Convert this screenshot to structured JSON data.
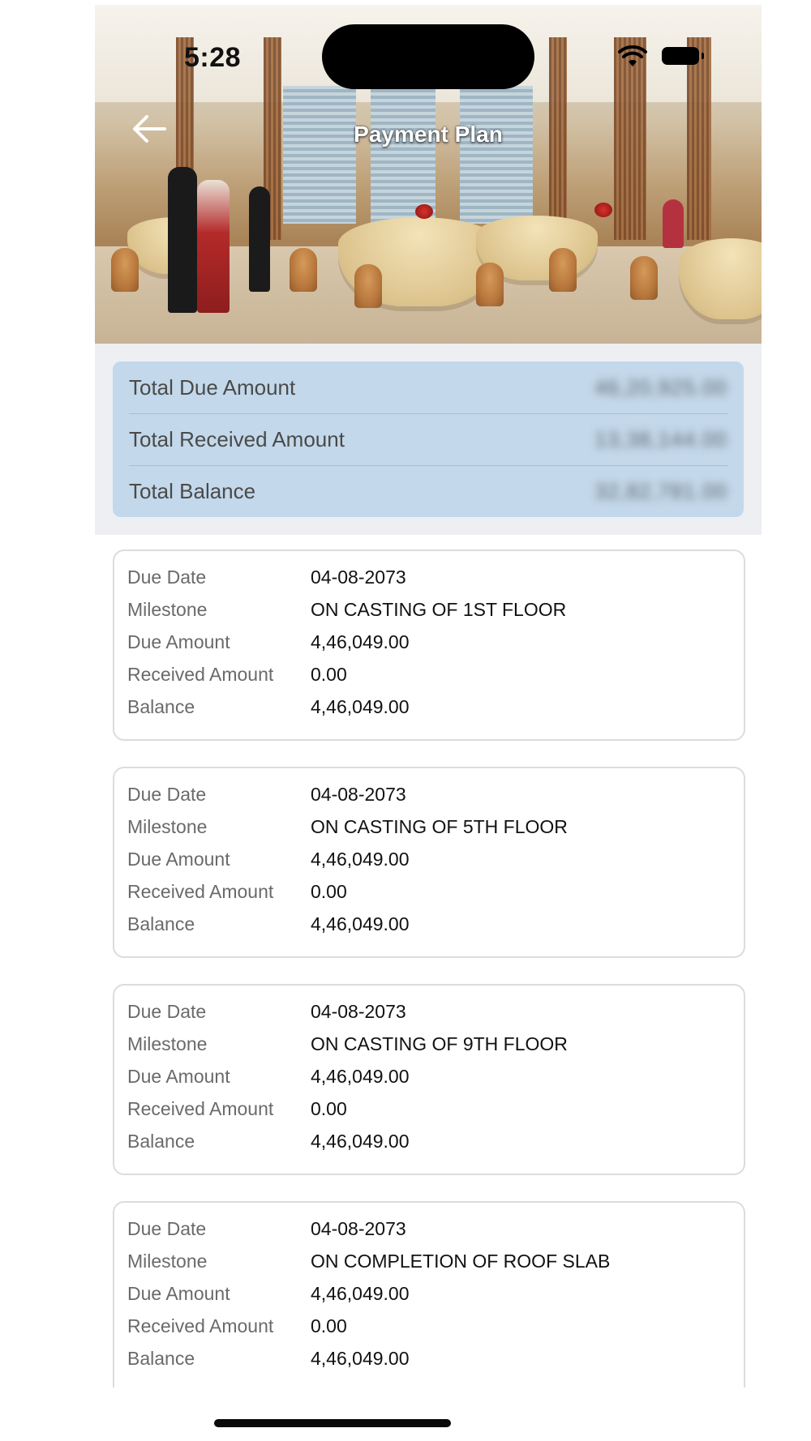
{
  "status_bar": {
    "time": "5:28"
  },
  "header": {
    "title": "Payment Plan"
  },
  "summary": [
    {
      "label": "Total Due Amount",
      "value": "46,20,925.00"
    },
    {
      "label": "Total Received Amount",
      "value": "13,38,144.00"
    },
    {
      "label": "Total Balance",
      "value": "32,82,781.00"
    }
  ],
  "field_labels": {
    "due_date": "Due Date",
    "milestone": "Milestone",
    "due_amount": "Due Amount",
    "received_amount": "Received Amount",
    "balance": "Balance"
  },
  "milestones": [
    {
      "due_date": "04-08-2073",
      "milestone": "ON CASTING OF 1ST FLOOR",
      "due_amount": "4,46,049.00",
      "received_amount": "0.00",
      "balance": "4,46,049.00"
    },
    {
      "due_date": "04-08-2073",
      "milestone": "ON CASTING OF 5TH FLOOR",
      "due_amount": "4,46,049.00",
      "received_amount": "0.00",
      "balance": "4,46,049.00"
    },
    {
      "due_date": "04-08-2073",
      "milestone": "ON CASTING OF 9TH FLOOR",
      "due_amount": "4,46,049.00",
      "received_amount": "0.00",
      "balance": "4,46,049.00"
    },
    {
      "due_date": "04-08-2073",
      "milestone": "ON COMPLETION OF ROOF SLAB",
      "due_amount": "4,46,049.00",
      "received_amount": "0.00",
      "balance": "4,46,049.00"
    }
  ],
  "icons": {
    "back": "arrow-left-icon",
    "wifi": "wifi-icon",
    "battery": "battery-icon"
  },
  "colors": {
    "summary_bg": "#c3d8ea",
    "summary_wrap_bg": "#eeeff3",
    "title_text": "#ffffff"
  }
}
